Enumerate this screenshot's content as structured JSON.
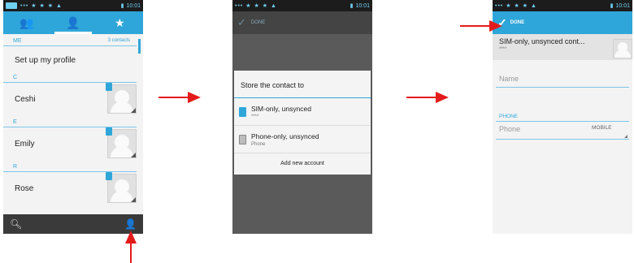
{
  "status": {
    "icons": "••• ★ ★ ★ ▲",
    "time": "10:01"
  },
  "screen1": {
    "section_me": "ME",
    "contact_count": "3 contacts",
    "profile_label": "Set up my profile",
    "contacts": [
      {
        "letter": "C",
        "name": "Ceshi"
      },
      {
        "letter": "E",
        "name": "Emily"
      },
      {
        "letter": "R",
        "name": "Rose"
      }
    ]
  },
  "screen2": {
    "header_done": "DONE",
    "dialog_title": "Store the contact to",
    "options": [
      {
        "title": "SIM-only, unsynced",
        "subtitle": "****"
      },
      {
        "title": "Phone-only, unsynced",
        "subtitle": "Phone"
      }
    ],
    "add_account": "Add new account"
  },
  "screen3": {
    "done_label": "DONE",
    "account_title": "SIM-only, unsynced cont...",
    "account_subtitle": "****",
    "name_placeholder": "Name",
    "phone_section": "PHONE",
    "phone_placeholder": "Phone",
    "phone_type": "MOBILE"
  },
  "colors": {
    "accent": "#2fa6d9",
    "arrow": "#e31b1b",
    "dark": "#3a3a3a"
  },
  "icons": [
    "groups-icon",
    "person-icon",
    "star-icon",
    "search-icon",
    "add-contact-icon",
    "check-icon",
    "sim-card-icon",
    "phone-device-icon"
  ]
}
